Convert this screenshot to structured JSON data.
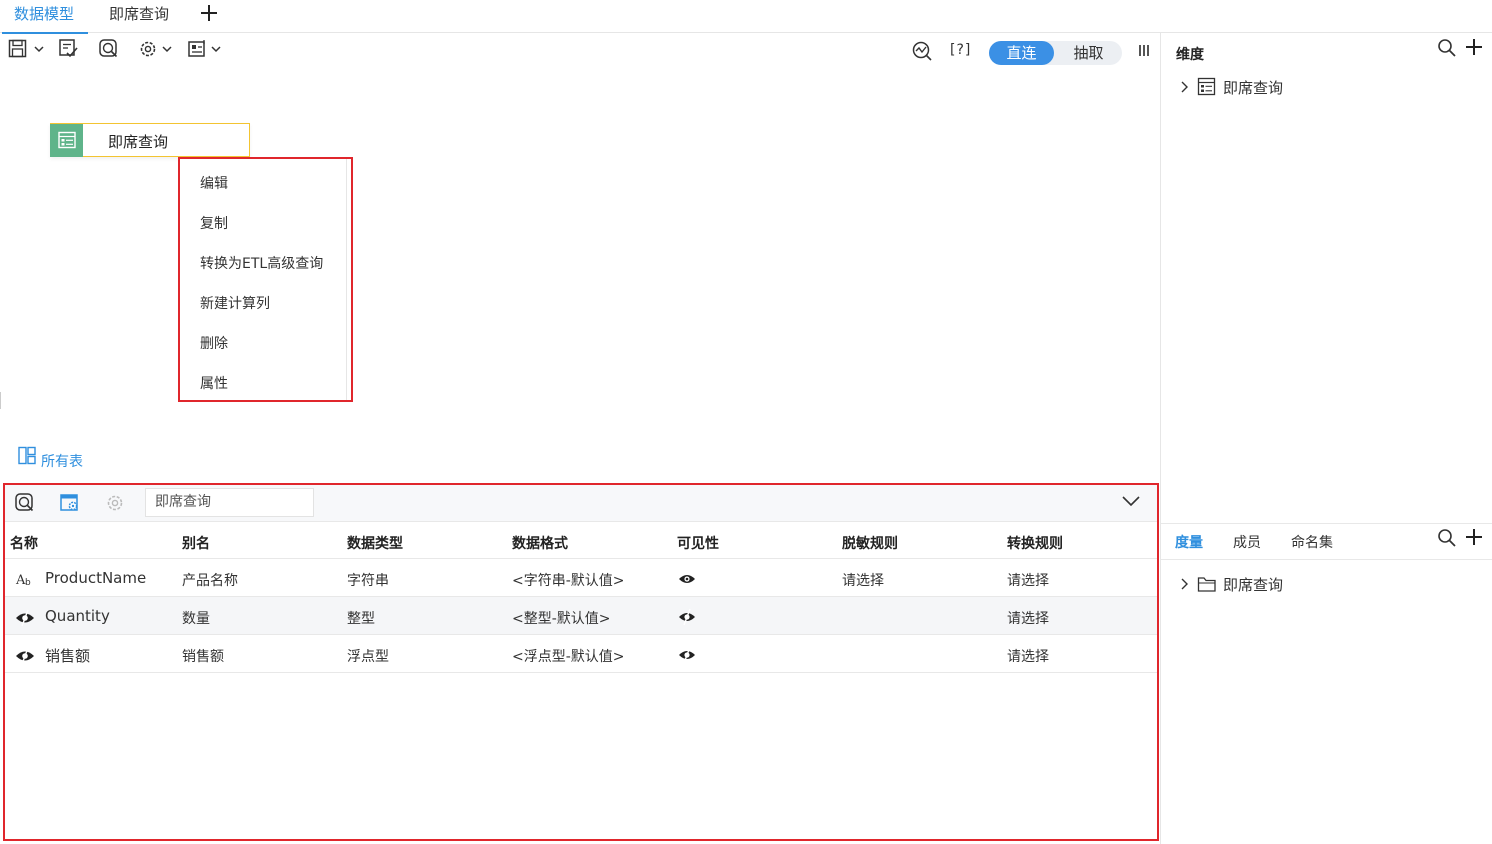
{
  "tabs": [
    {
      "label": "数据模型",
      "active": true
    },
    {
      "label": "即席查询",
      "active": false
    }
  ],
  "toolbar": {
    "help_bracket": "[?]",
    "mode_on": "直连",
    "mode_off": "抽取"
  },
  "canvas": {
    "node_label": "即席查询",
    "all_tables_label": "所有表"
  },
  "context_menu": {
    "items": [
      "编辑",
      "复制",
      "转换为ETL高级查询",
      "新建计算列",
      "删除",
      "属性"
    ]
  },
  "bottom_panel": {
    "search_value": "即席查询",
    "columns": [
      "名称",
      "别名",
      "数据类型",
      "数据格式",
      "可见性",
      "脱敏规则",
      "转换规则"
    ],
    "rows": [
      {
        "icon": "text-field-icon",
        "name": "ProductName",
        "alias": "产品名称",
        "type": "字符串",
        "format": "<字符串-默认值>",
        "visible": true,
        "mask": "请选择",
        "convert": "请选择"
      },
      {
        "icon": "measure-field-icon",
        "name": "Quantity",
        "alias": "数量",
        "type": "整型",
        "format": "<整型-默认值>",
        "visible": false,
        "mask": "",
        "convert": "请选择"
      },
      {
        "icon": "measure-field-icon",
        "name": "销售额",
        "alias": "销售额",
        "type": "浮点型",
        "format": "<浮点型-默认值>",
        "visible": false,
        "mask": "",
        "convert": "请选择"
      }
    ]
  },
  "right_panel": {
    "dimension_title": "维度",
    "dimension_tree": [
      "即席查询"
    ],
    "lower_tabs": [
      {
        "label": "度量",
        "active": true
      },
      {
        "label": "成员",
        "active": false
      },
      {
        "label": "命名集",
        "active": false
      }
    ],
    "measure_tree": [
      "即席查询"
    ]
  },
  "colors": {
    "accent": "#2f8fde",
    "highlight_border": "#e0262c",
    "node_icon": "#5fb48a",
    "node_border": "#f3c431"
  }
}
